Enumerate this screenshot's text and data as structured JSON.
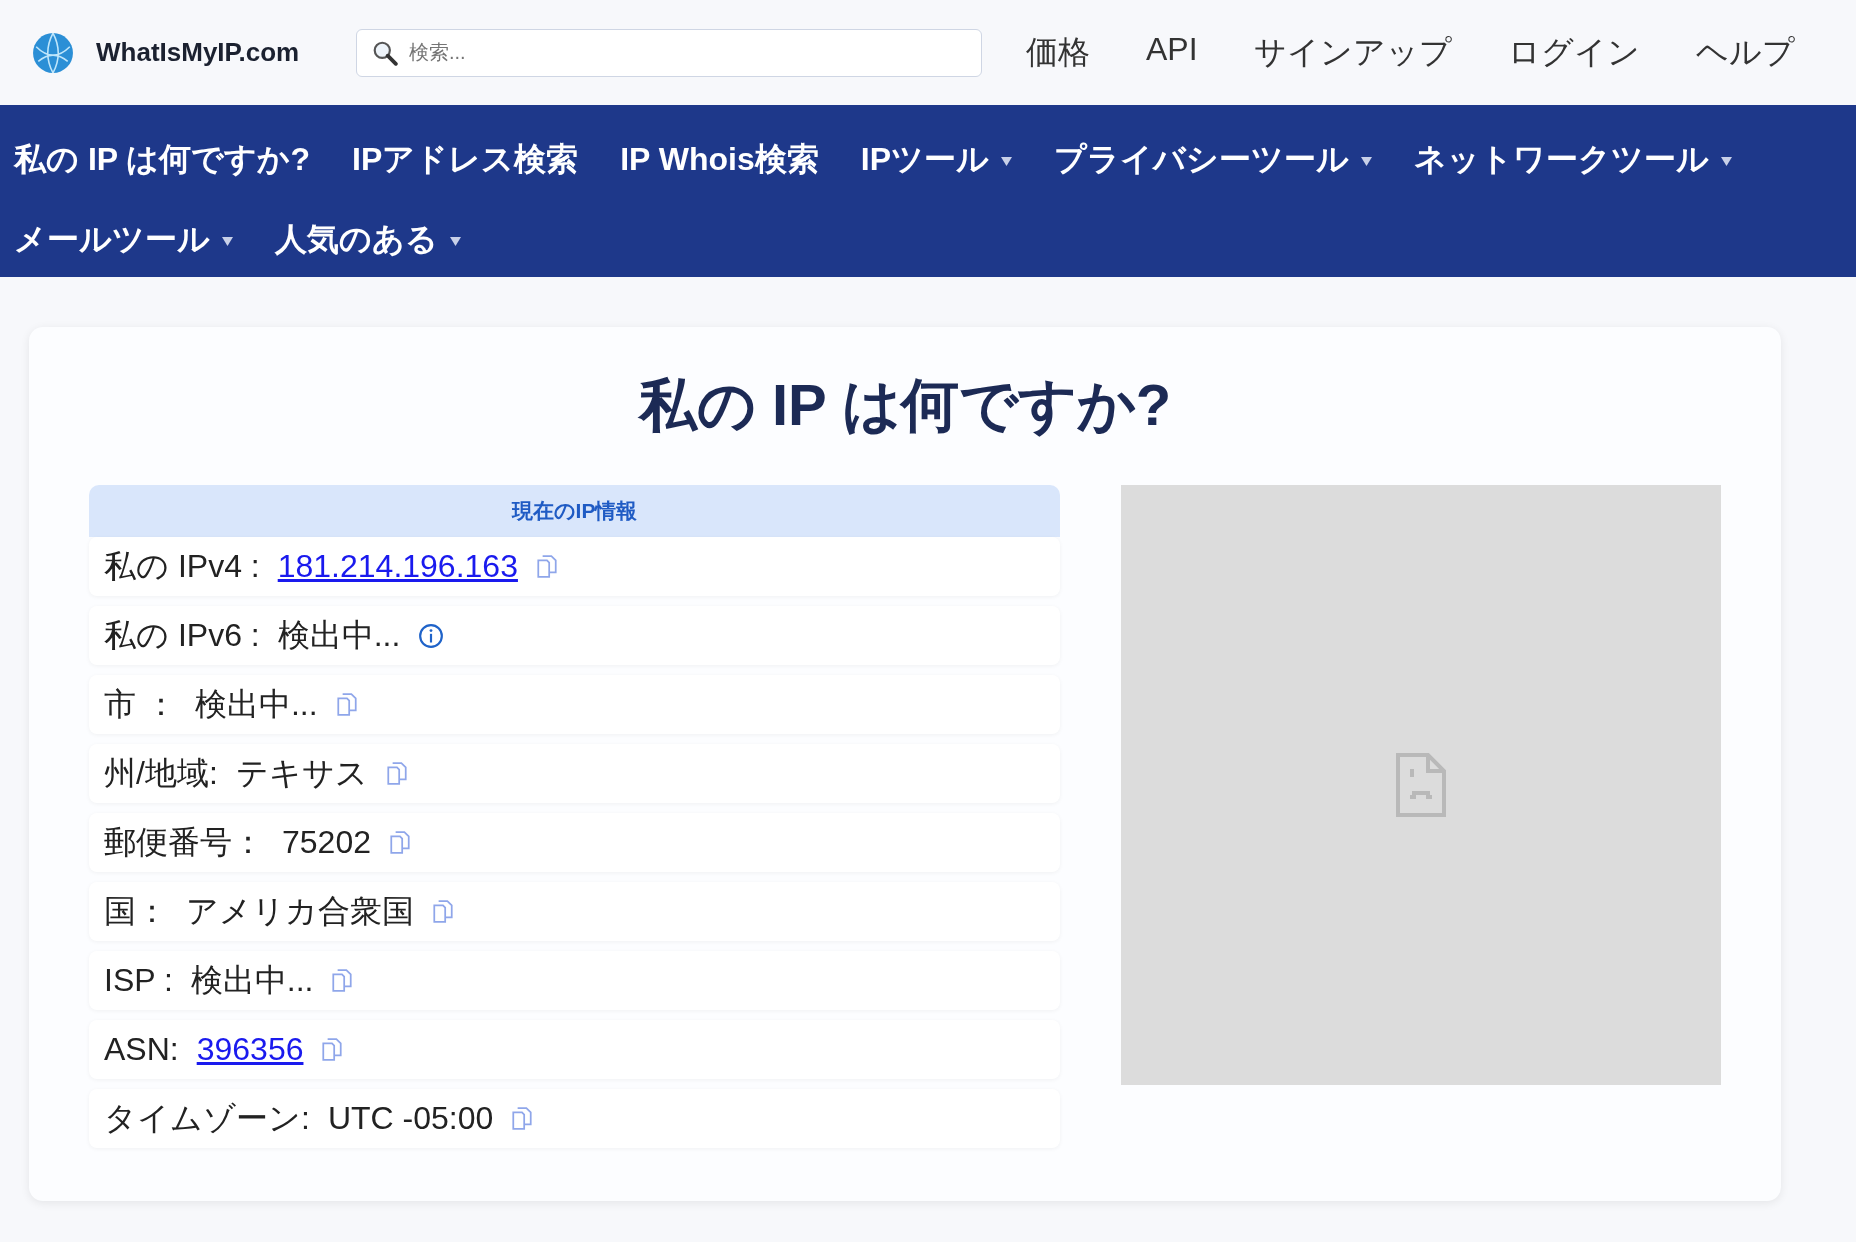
{
  "header": {
    "logo_text": "WhatIsMyIP.com",
    "search": {
      "placeholder": "検索..."
    },
    "links": [
      "価格",
      "API",
      "サインアップ",
      "ログイン",
      "ヘルプ"
    ]
  },
  "nav": [
    {
      "label": "私の IP は何ですか?",
      "dropdown": false
    },
    {
      "label": "IPアドレス検索",
      "dropdown": false
    },
    {
      "label": "IP Whois検索",
      "dropdown": false
    },
    {
      "label": "IPツール",
      "dropdown": true
    },
    {
      "label": "プライバシーツール",
      "dropdown": true
    },
    {
      "label": "ネットワークツール",
      "dropdown": true
    },
    {
      "label": "メールツール",
      "dropdown": true
    },
    {
      "label": "人気のある",
      "dropdown": true
    }
  ],
  "title": "私の IP は何ですか?",
  "table": {
    "heading": "現在のIP情報",
    "rows": [
      {
        "label": "私の IPv4 :",
        "value": "181.214.196.163",
        "kind": "link"
      },
      {
        "label": "私の IPv6 :",
        "value": "検出中...",
        "kind": "note"
      },
      {
        "label": "市 ：",
        "value": "検出中...",
        "kind": "text"
      },
      {
        "label": "州/地域:",
        "value": "テキサス",
        "kind": "text"
      },
      {
        "label": "郵便番号：",
        "value": "75202",
        "kind": "text"
      },
      {
        "label": "国：",
        "value": "アメリカ合衆国",
        "kind": "text"
      },
      {
        "label": "ISP :",
        "value": "検出中...",
        "kind": "text"
      },
      {
        "label": "ASN:",
        "value": "396356",
        "kind": "link"
      },
      {
        "label": "タイムゾーン:",
        "value": "UTC -05:00",
        "kind": "text"
      }
    ]
  },
  "map": {
    "kind": "broken-image"
  }
}
